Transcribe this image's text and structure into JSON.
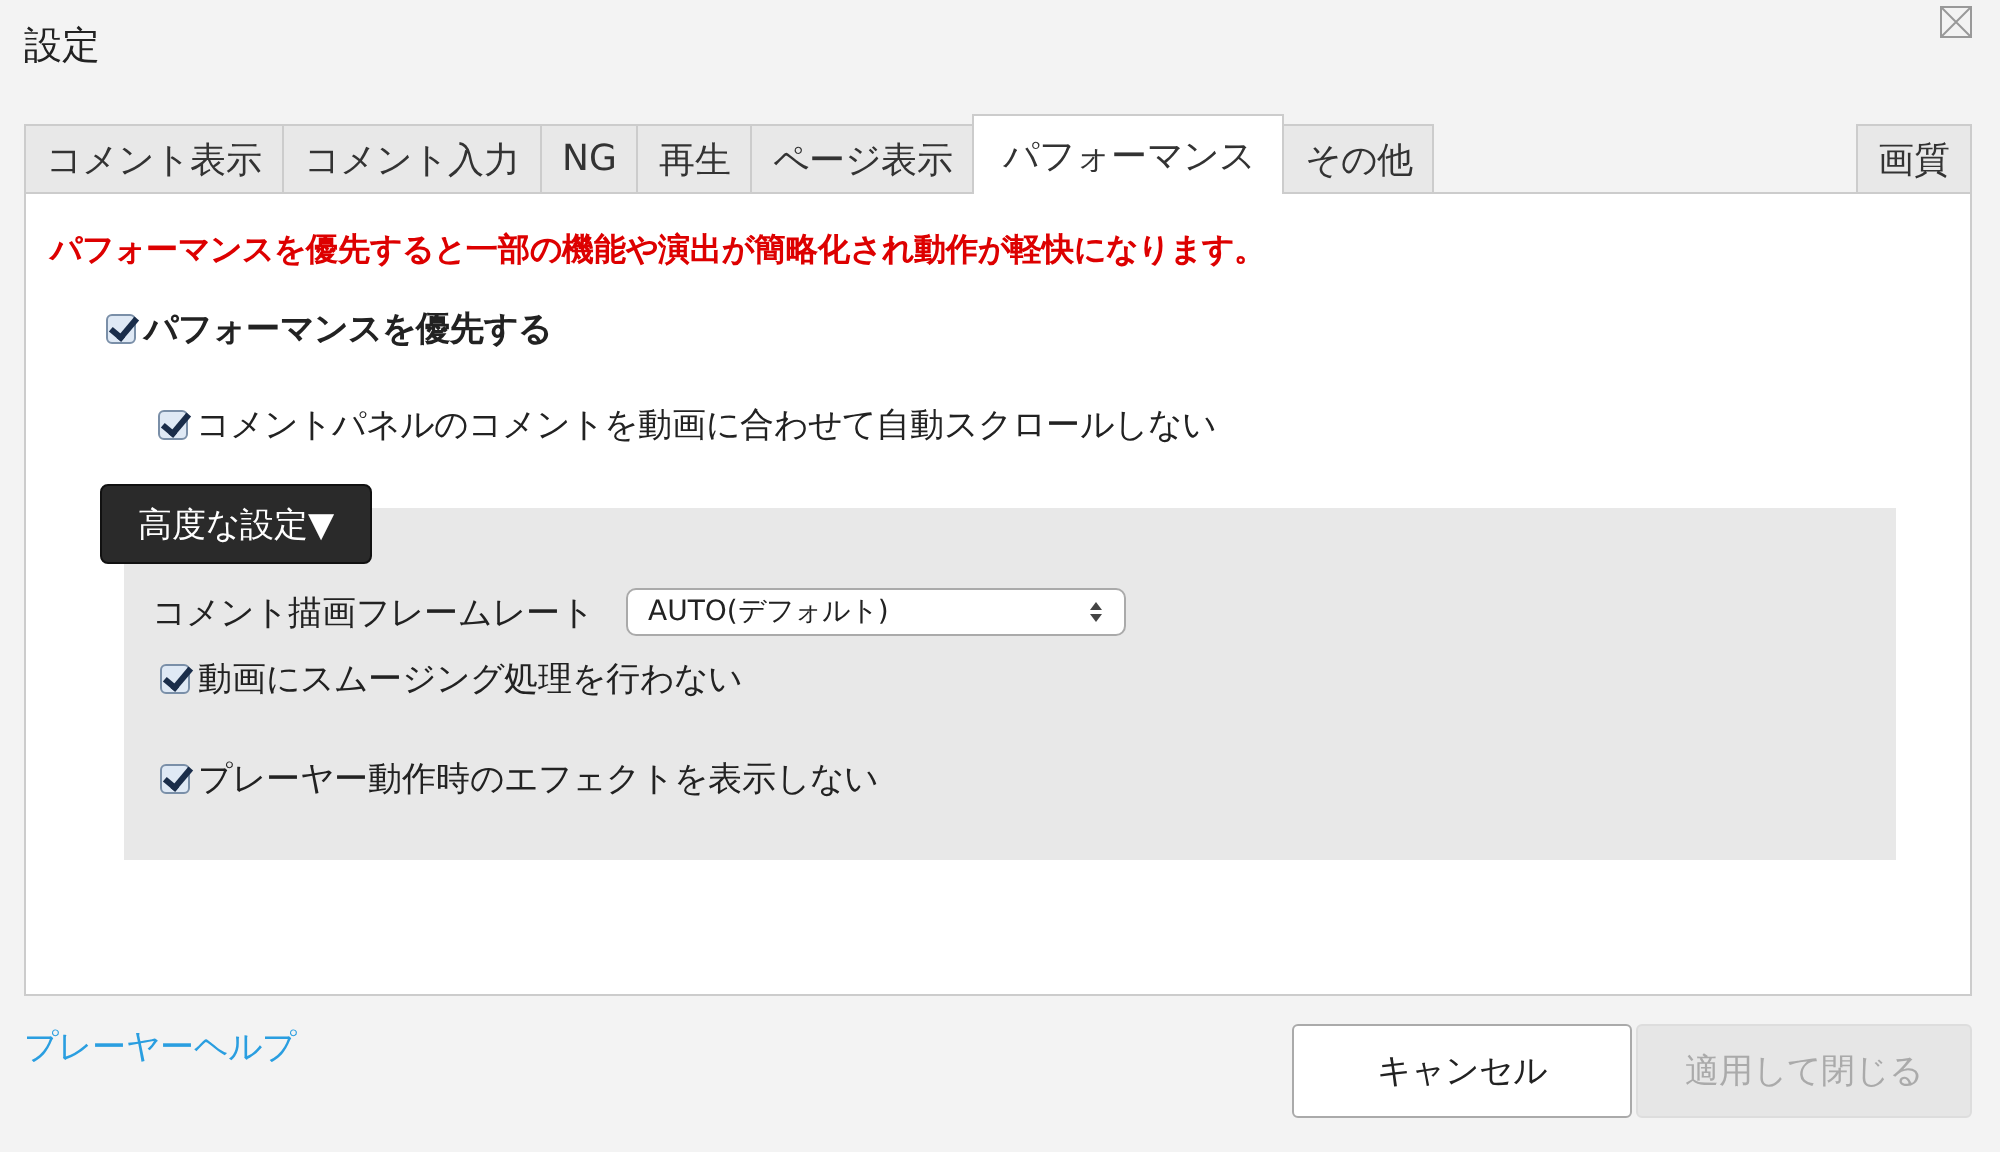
{
  "window": {
    "title": "設定"
  },
  "tabs": [
    {
      "label": "コメント表示",
      "selected": false
    },
    {
      "label": "コメント入力",
      "selected": false
    },
    {
      "label": "NG",
      "selected": false
    },
    {
      "label": "再生",
      "selected": false
    },
    {
      "label": "ページ表示",
      "selected": false
    },
    {
      "label": "パフォーマンス",
      "selected": true
    },
    {
      "label": "その他",
      "selected": false
    }
  ],
  "side_tabs": [
    {
      "label": "画質",
      "selected": false
    }
  ],
  "notice": "パフォーマンスを優先すると一部の機能や演出が簡略化され動作が軽快になります。",
  "main_option": {
    "label": "パフォーマンスを優先する",
    "checked": true
  },
  "sub_options": [
    {
      "label": "コメントパネルのコメントを動画に合わせて自動スクロールしない",
      "checked": true
    }
  ],
  "advanced": {
    "button": "高度な設定▼",
    "expanded": true,
    "items": [
      {
        "kind": "select",
        "label": "コメント描画フレームレート",
        "value": "AUTO(デフォルト)"
      },
      {
        "kind": "checkbox",
        "label": "動画にスムージング処理を行わない",
        "checked": true
      },
      {
        "kind": "checkbox",
        "label": "プレーヤー動作時のエフェクトを表示しない",
        "checked": true
      }
    ]
  },
  "help_link": "プレーヤーヘルプ",
  "buttons": [
    {
      "label": "キャンセル",
      "disabled": false
    },
    {
      "label": "適用して閉じる",
      "disabled": true
    }
  ]
}
